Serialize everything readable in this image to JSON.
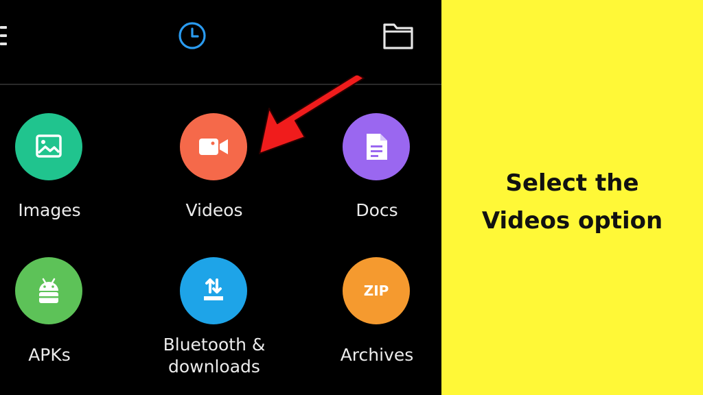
{
  "app": {
    "top_bar": {
      "menu_icon": "hamburger-menu-icon",
      "recent_icon": "clock-icon",
      "folder_icon": "folder-icon",
      "accent_color": "#2a9bf0"
    },
    "categories": [
      {
        "label": "Images",
        "icon": "image-icon",
        "color": "#20c48e"
      },
      {
        "label": "Videos",
        "icon": "video-camera-icon",
        "color": "#f5694a"
      },
      {
        "label": "Docs",
        "icon": "document-icon",
        "color": "#9a67f0"
      },
      {
        "label": "APKs",
        "icon": "android-icon",
        "color": "#5dc258"
      },
      {
        "label": "Bluetooth &",
        "label_line2": "downloads",
        "icon": "download-transfer-icon",
        "color": "#1ea4e8"
      },
      {
        "label": "Archives",
        "icon": "zip-icon",
        "color": "#f59a2f",
        "icon_text": "ZIP"
      }
    ]
  },
  "annotation": {
    "arrow_color": "#f01c1c",
    "panel_color": "#fff837",
    "line1": "Select the",
    "line2": "Videos option"
  }
}
